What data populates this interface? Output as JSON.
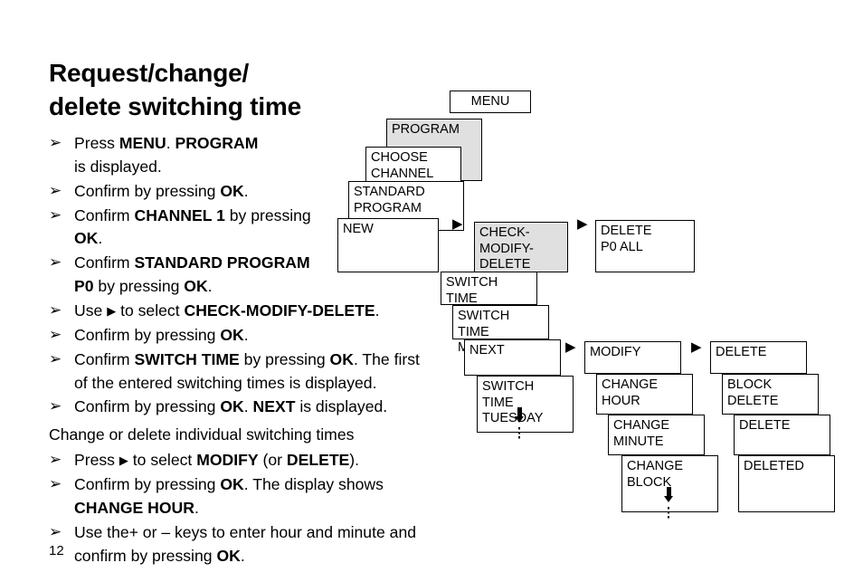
{
  "heading": {
    "line1": "Request/change/",
    "line2": "delete switching time"
  },
  "page_number": "12",
  "instructions": {
    "bullet_glyph": "➢",
    "arrow_glyph": "▶",
    "steps": [
      {
        "type": "bullet",
        "parts": [
          {
            "t": "Press ",
            "b": false
          },
          {
            "t": "MENU",
            "b": true
          },
          {
            "t": ". ",
            "b": false
          },
          {
            "t": "PROGRAM",
            "b": true
          },
          {
            "t": "\nis displayed.",
            "b": false
          }
        ]
      },
      {
        "type": "bullet",
        "parts": [
          {
            "t": "Confirm by pressing ",
            "b": false
          },
          {
            "t": "OK",
            "b": true
          },
          {
            "t": ".",
            "b": false
          }
        ]
      },
      {
        "type": "bullet",
        "parts": [
          {
            "t": "Confirm ",
            "b": false
          },
          {
            "t": "CHANNEL 1",
            "b": true
          },
          {
            "t": " by pressing\n",
            "b": false
          },
          {
            "t": "OK",
            "b": true
          },
          {
            "t": ".",
            "b": false
          }
        ]
      },
      {
        "type": "bullet",
        "parts": [
          {
            "t": "Confirm ",
            "b": false
          },
          {
            "t": "STANDARD PROGRAM\nP0",
            "b": true
          },
          {
            "t": " by pressing ",
            "b": false
          },
          {
            "t": "OK",
            "b": true
          },
          {
            "t": ".",
            "b": false
          }
        ]
      },
      {
        "type": "bullet",
        "parts": [
          {
            "t": "Use ",
            "b": false
          },
          {
            "t": "▶",
            "b": false,
            "arrow": true
          },
          {
            "t": " to select ",
            "b": false
          },
          {
            "t": "CHECK-MODIFY-DELETE",
            "b": true
          },
          {
            "t": ".",
            "b": false
          }
        ]
      },
      {
        "type": "bullet",
        "parts": [
          {
            "t": "Confirm by pressing ",
            "b": false
          },
          {
            "t": "OK",
            "b": true
          },
          {
            "t": ".",
            "b": false
          }
        ]
      },
      {
        "type": "bullet",
        "parts": [
          {
            "t": "Confirm ",
            "b": false
          },
          {
            "t": "SWITCH TIME",
            "b": true
          },
          {
            "t": " by pressing ",
            "b": false
          },
          {
            "t": "OK",
            "b": true
          },
          {
            "t": ". The first\nof the entered switching times is displayed.",
            "b": false
          }
        ]
      },
      {
        "type": "bullet",
        "parts": [
          {
            "t": "Confirm by pressing ",
            "b": false
          },
          {
            "t": "OK",
            "b": true
          },
          {
            "t": ". ",
            "b": false
          },
          {
            "t": "NEXT",
            "b": true
          },
          {
            "t": " is displayed.",
            "b": false
          }
        ]
      },
      {
        "type": "plain",
        "parts": [
          {
            "t": "Change or delete individual switching times",
            "b": false
          }
        ]
      },
      {
        "type": "bullet",
        "parts": [
          {
            "t": "Press ",
            "b": false
          },
          {
            "t": "▶",
            "b": false,
            "arrow": true
          },
          {
            "t": " to select ",
            "b": false
          },
          {
            "t": "MODIFY",
            "b": true
          },
          {
            "t": " (or ",
            "b": false
          },
          {
            "t": "DELETE",
            "b": true
          },
          {
            "t": ").",
            "b": false
          }
        ]
      },
      {
        "type": "bullet",
        "parts": [
          {
            "t": "Confirm by pressing ",
            "b": false
          },
          {
            "t": "OK",
            "b": true
          },
          {
            "t": ". The display shows\n",
            "b": false
          },
          {
            "t": "CHANGE HOUR",
            "b": true
          },
          {
            "t": ".",
            "b": false
          }
        ]
      },
      {
        "type": "bullet",
        "parts": [
          {
            "t": "Use the+ or – keys to enter hour and minute and\nconfirm by pressing ",
            "b": false
          },
          {
            "t": "OK",
            "b": true
          },
          {
            "t": ".",
            "b": false
          }
        ]
      }
    ]
  },
  "diagram": {
    "colors": {
      "shaded_fill": "#e0e0e0",
      "border": "#000000",
      "background": "#ffffff"
    },
    "nodes": [
      {
        "id": "menu",
        "label": "MENU",
        "shaded": false
      },
      {
        "id": "program",
        "label": "PROGRAM",
        "shaded": true
      },
      {
        "id": "choose-channel",
        "label": "CHOOSE\nCHANNEL",
        "shaded": false
      },
      {
        "id": "standard-program",
        "label": "STANDARD\nPROGRAM",
        "shaded": false
      },
      {
        "id": "new",
        "label": "NEW",
        "shaded": false
      },
      {
        "id": "check-modify-delete",
        "label": "CHECK-\nMODIFY-\nDELETE",
        "shaded": true
      },
      {
        "id": "delete-p0-all",
        "label": "DELETE\nP0 ALL",
        "shaded": false
      },
      {
        "id": "switch-time",
        "label": "SWITCH TIME",
        "shaded": false
      },
      {
        "id": "switch-time-monday",
        "label": "SWITCH TIME\nMONDAY",
        "shaded": false
      },
      {
        "id": "next",
        "label": "NEXT",
        "shaded": false
      },
      {
        "id": "switch-time-tuesday",
        "label": "SWITCH TIME\nTUESDAY",
        "shaded": false
      },
      {
        "id": "modify",
        "label": "MODIFY",
        "shaded": false
      },
      {
        "id": "change-hour",
        "label": "CHANGE\nHOUR",
        "shaded": false
      },
      {
        "id": "change-minute",
        "label": "CHANGE\nMINUTE",
        "shaded": false
      },
      {
        "id": "change-block",
        "label": "CHANGE\nBLOCK",
        "shaded": false
      },
      {
        "id": "delete",
        "label": "DELETE",
        "shaded": false
      },
      {
        "id": "block-delete",
        "label": "BLOCK\nDELETE",
        "shaded": false
      },
      {
        "id": "delete-2",
        "label": "DELETE",
        "shaded": false
      },
      {
        "id": "deleted",
        "label": "DELETED",
        "shaded": false
      }
    ],
    "flow_arrows": [
      "▶",
      "▶",
      "▶",
      "▶"
    ]
  }
}
